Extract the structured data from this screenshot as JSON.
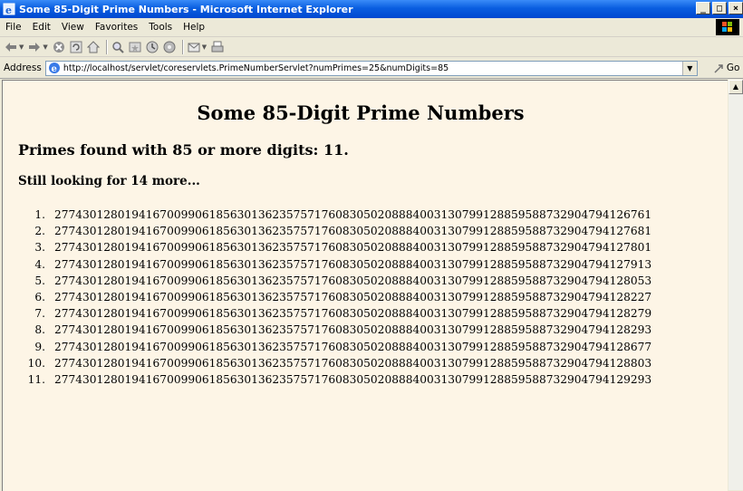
{
  "window": {
    "title": "Some 85-Digit Prime Numbers - Microsoft Internet Explorer",
    "buttons": [
      "_",
      "□",
      "×"
    ]
  },
  "menu": {
    "items": [
      "File",
      "Edit",
      "View",
      "Favorites",
      "Tools",
      "Help"
    ]
  },
  "toolbar": {
    "icons": [
      "back-icon",
      "forward-icon",
      "stop-icon",
      "refresh-icon",
      "home-icon",
      "search-icon",
      "favorites-icon",
      "history-icon",
      "media-icon",
      "mail-icon",
      "print-icon"
    ]
  },
  "address": {
    "label": "Address",
    "url": "http://localhost/servlet/coreservlets.PrimeNumberServlet?numPrimes=25&numDigits=85",
    "go_label": "Go"
  },
  "page": {
    "heading": "Some 85-Digit Prime Numbers",
    "found": "Primes found with 85 or more digits: 11.",
    "looking": "Still looking for 14 more...",
    "primes": [
      {
        "index": "1.",
        "value": "2774301280194167009906185630136235757176083050208884003130799128859588732904794126761"
      },
      {
        "index": "2.",
        "value": "2774301280194167009906185630136235757176083050208884003130799128859588732904794127681"
      },
      {
        "index": "3.",
        "value": "2774301280194167009906185630136235757176083050208884003130799128859588732904794127801"
      },
      {
        "index": "4.",
        "value": "2774301280194167009906185630136235757176083050208884003130799128859588732904794127913"
      },
      {
        "index": "5.",
        "value": "2774301280194167009906185630136235757176083050208884003130799128859588732904794128053"
      },
      {
        "index": "6.",
        "value": "2774301280194167009906185630136235757176083050208884003130799128859588732904794128227"
      },
      {
        "index": "7.",
        "value": "2774301280194167009906185630136235757176083050208884003130799128859588732904794128279"
      },
      {
        "index": "8.",
        "value": "2774301280194167009906185630136235757176083050208884003130799128859588732904794128293"
      },
      {
        "index": "9.",
        "value": "2774301280194167009906185630136235757176083050208884003130799128859588732904794128677"
      },
      {
        "index": "10.",
        "value": "2774301280194167009906185630136235757176083050208884003130799128859588732904794128803"
      },
      {
        "index": "11.",
        "value": "2774301280194167009906185630136235757176083050208884003130799128859588732904794129293"
      }
    ]
  },
  "colors": {
    "titlebar": "#0a5ee0",
    "chrome": "#ece9d8",
    "page_background": "#fdf5e6"
  }
}
